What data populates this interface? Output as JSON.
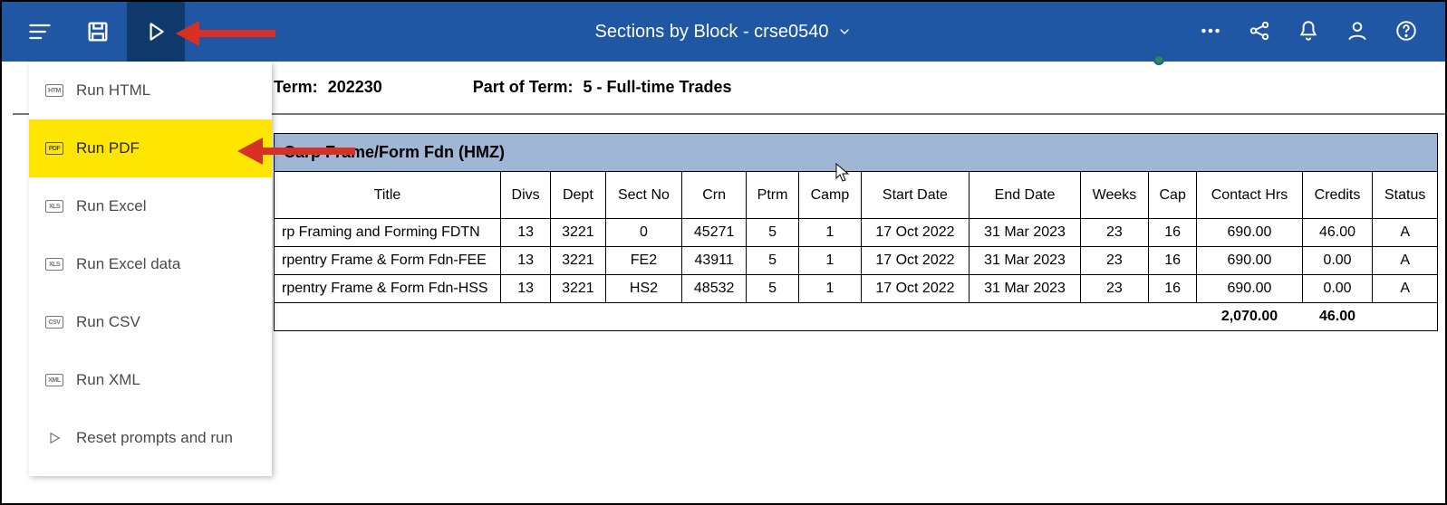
{
  "toolbar": {
    "title": "Sections by Block - crse0540"
  },
  "dropdown": {
    "items": [
      {
        "icon": "HTM",
        "label": "Run HTML"
      },
      {
        "icon": "PDF",
        "label": "Run PDF"
      },
      {
        "icon": "XLS",
        "label": "Run Excel"
      },
      {
        "icon": "XLS",
        "label": "Run Excel data"
      },
      {
        "icon": "CSV",
        "label": "Run CSV"
      },
      {
        "icon": "XML",
        "label": "Run XML"
      },
      {
        "icon": "play",
        "label": "Reset prompts and run"
      }
    ]
  },
  "context": {
    "term_label": "Term:",
    "term_value": "202230",
    "pot_label": "Part of Term:",
    "pot_value": "5 - Full-time Trades"
  },
  "block": {
    "title_prefix": "Carp Frame/Form Fdn (HMZ)"
  },
  "table": {
    "headers": [
      "Title",
      "Divs",
      "Dept",
      "Sect No",
      "Crn",
      "Ptrm",
      "Camp",
      "Start Date",
      "End Date",
      "Weeks",
      "Cap",
      "Contact Hrs",
      "Credits",
      "Status"
    ],
    "rows": [
      {
        "title": "rp Framing and Forming FDTN",
        "divs": "13",
        "dept": "3221",
        "sect": "0",
        "crn": "45271",
        "ptrm": "5",
        "camp": "1",
        "start": "17 Oct 2022",
        "end": "31 Mar 2023",
        "weeks": "23",
        "cap": "16",
        "contact": "690.00",
        "credits": "46.00",
        "status": "A"
      },
      {
        "title": "rpentry Frame & Form Fdn-FEE",
        "divs": "13",
        "dept": "3221",
        "sect": "FE2",
        "crn": "43911",
        "ptrm": "5",
        "camp": "1",
        "start": "17 Oct 2022",
        "end": "31 Mar 2023",
        "weeks": "23",
        "cap": "16",
        "contact": "690.00",
        "credits": "0.00",
        "status": "A"
      },
      {
        "title": "rpentry Frame & Form Fdn-HSS",
        "divs": "13",
        "dept": "3221",
        "sect": "HS2",
        "crn": "48532",
        "ptrm": "5",
        "camp": "1",
        "start": "17 Oct 2022",
        "end": "31 Mar 2023",
        "weeks": "23",
        "cap": "16",
        "contact": "690.00",
        "credits": "0.00",
        "status": "A"
      }
    ],
    "totals": {
      "contact": "2,070.00",
      "credits": "46.00"
    }
  }
}
